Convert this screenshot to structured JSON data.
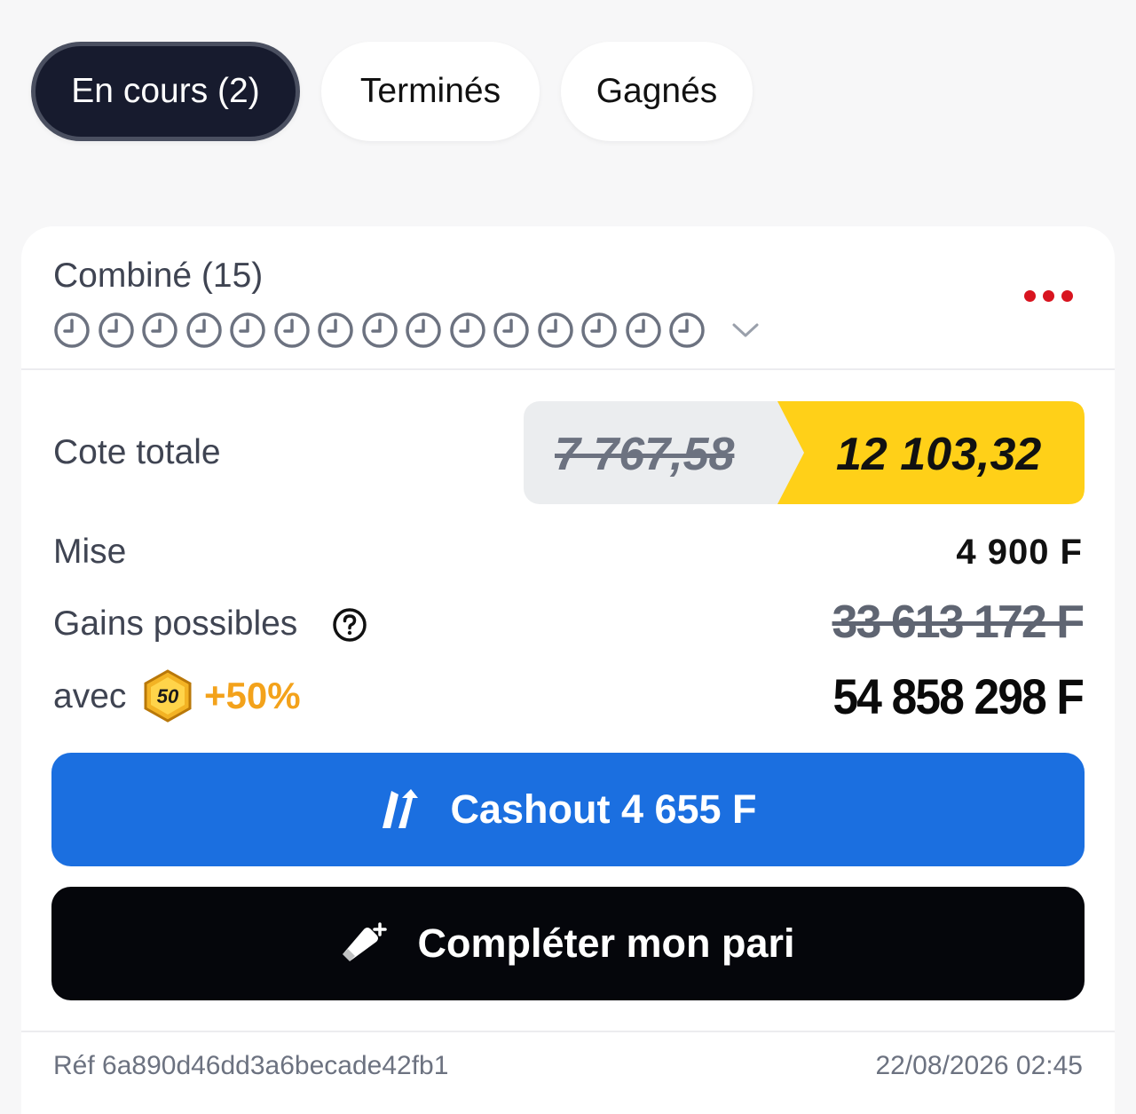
{
  "tabs": [
    {
      "label": "En cours (2)",
      "active": true
    },
    {
      "label": "Terminés",
      "active": false
    },
    {
      "label": "Gagnés",
      "active": false
    }
  ],
  "bet": {
    "title": "Combiné (15)",
    "selection_count": 15,
    "selection_icon": "clock-icon",
    "more_icon": "more-dots-icon",
    "cote_label": "Cote totale",
    "cote_old": "7 767,58",
    "cote_new": "12 103,32",
    "mise_label": "Mise",
    "mise_value": "4 900 F",
    "gains_label": "Gains possibles",
    "gains_old": "33 613 172 F",
    "avec_label": "avec",
    "bonus_badge": "50",
    "bonus_pct": "+50%",
    "gains_new": "54 858 298 F"
  },
  "actions": {
    "cashout_label": "Cashout 4 655 F",
    "complete_label": "Compléter mon pari"
  },
  "footer": {
    "ref": "Réf 6a890d46dd3a6becade42fb1",
    "date": "22/08/2026 02:45"
  },
  "colors": {
    "accent_blue": "#1b6fe0",
    "boost_yellow": "#ffd018",
    "bonus_orange": "#f3a21b",
    "dots_red": "#d8141f",
    "dark_tab": "#171b2e"
  }
}
